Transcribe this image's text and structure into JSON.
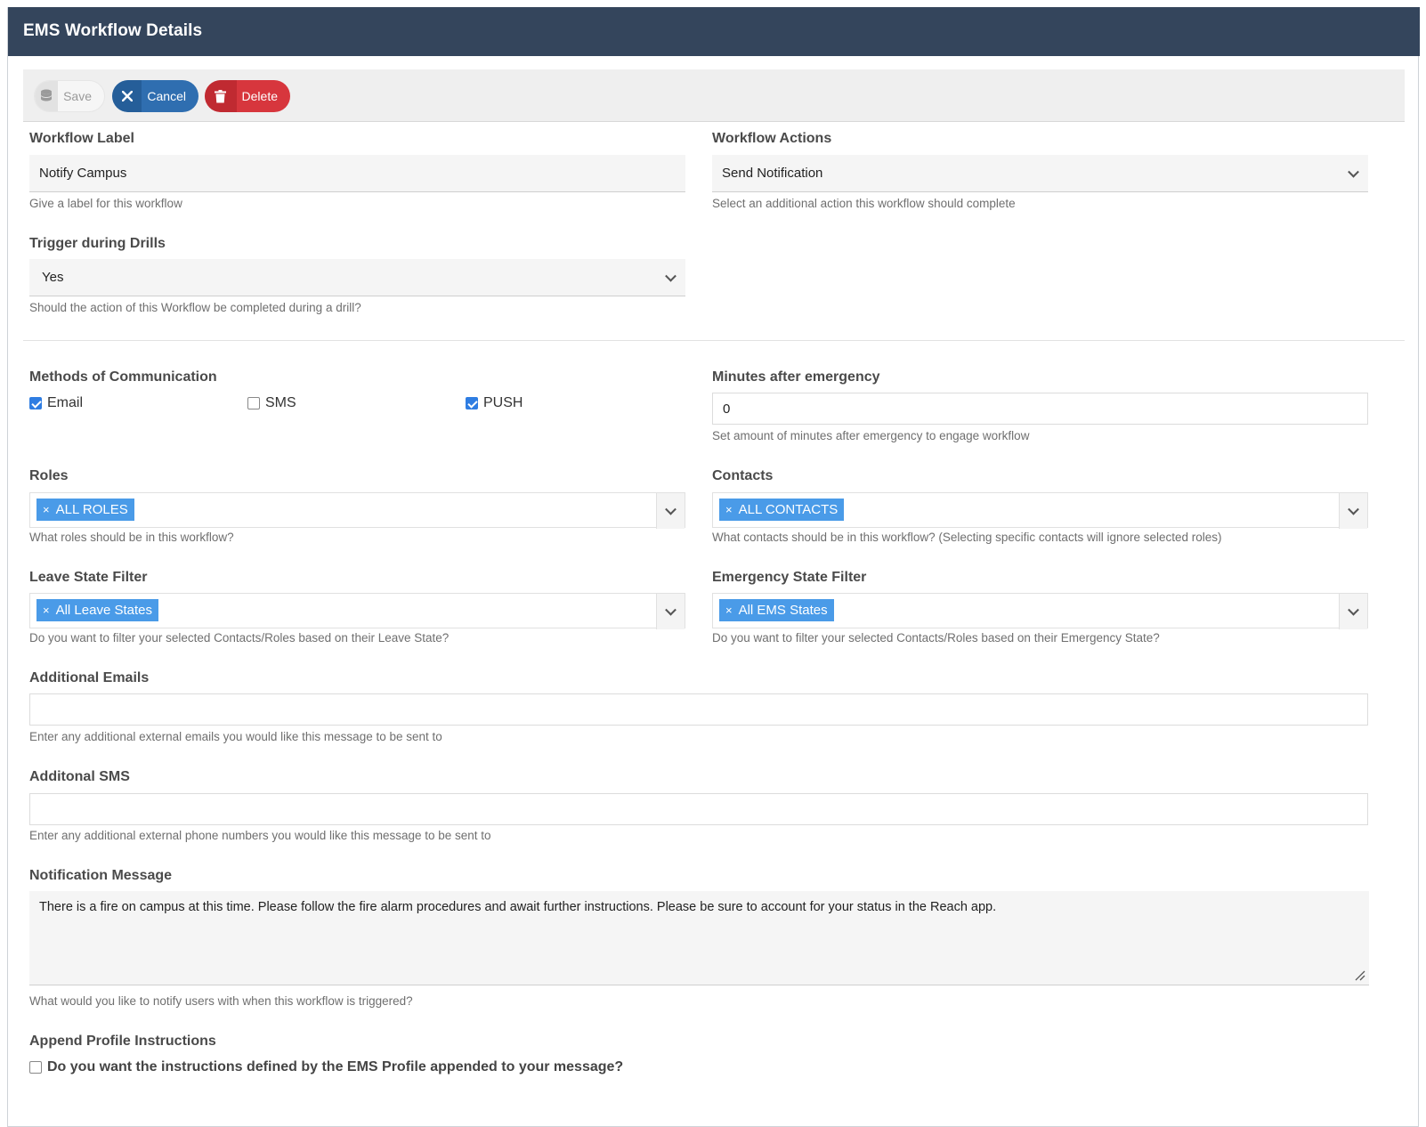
{
  "header": {
    "title": "EMS Workflow Details"
  },
  "toolbar": {
    "save_label": "Save",
    "cancel_label": "Cancel",
    "delete_label": "Delete"
  },
  "workflow_label": {
    "label": "Workflow Label",
    "value": "Notify Campus",
    "help": "Give a label for this workflow"
  },
  "workflow_actions": {
    "label": "Workflow Actions",
    "value": "Send Notification",
    "help": "Select an additional action this workflow should complete"
  },
  "trigger_drills": {
    "label": "Trigger during Drills",
    "value": "Yes",
    "help": "Should the action of this Workflow be completed during a drill?"
  },
  "methods": {
    "label": "Methods of Communication",
    "options": [
      {
        "label": "Email",
        "checked": true
      },
      {
        "label": "SMS",
        "checked": false
      },
      {
        "label": "PUSH",
        "checked": true
      }
    ]
  },
  "minutes": {
    "label": "Minutes after emergency",
    "value": "0",
    "help": "Set amount of minutes after emergency to engage workflow"
  },
  "roles": {
    "label": "Roles",
    "tag": "ALL ROLES",
    "help": "What roles should be in this workflow?"
  },
  "contacts": {
    "label": "Contacts",
    "tag": "ALL CONTACTS",
    "help": "What contacts should be in this workflow? (Selecting specific contacts will ignore selected roles)"
  },
  "leave_state": {
    "label": "Leave State Filter",
    "tag": "All Leave States",
    "help": "Do you want to filter your selected Contacts/Roles based on their Leave State?"
  },
  "emergency_state": {
    "label": "Emergency State Filter",
    "tag": "All EMS States",
    "help": "Do you want to filter your selected Contacts/Roles based on their Emergency State?"
  },
  "additional_emails": {
    "label": "Additional Emails",
    "value": "",
    "help": "Enter any additional external emails you would like this message to be sent to"
  },
  "additional_sms": {
    "label": "Additonal SMS",
    "value": "",
    "help": "Enter any additional external phone numbers you would like this message to be sent to"
  },
  "notification_message": {
    "label": "Notification Message",
    "value": "There is a fire on campus at this time.  Please follow the fire alarm procedures and await further instructions.  Please be sure to account for your status in the Reach app.",
    "help": "What would you like to notify users with when this workflow is triggered?"
  },
  "append_profile": {
    "label": "Append Profile Instructions",
    "checkbox_label": "Do you want the instructions defined by the EMS Profile appended to your message?",
    "checked": false
  },
  "tag_remove_symbol": "×",
  "colors": {
    "header_bg": "#34455c",
    "cancel": "#2f6eb0",
    "delete": "#d7363d",
    "tag": "#4a9be8",
    "checkbox": "#2f7de2"
  }
}
